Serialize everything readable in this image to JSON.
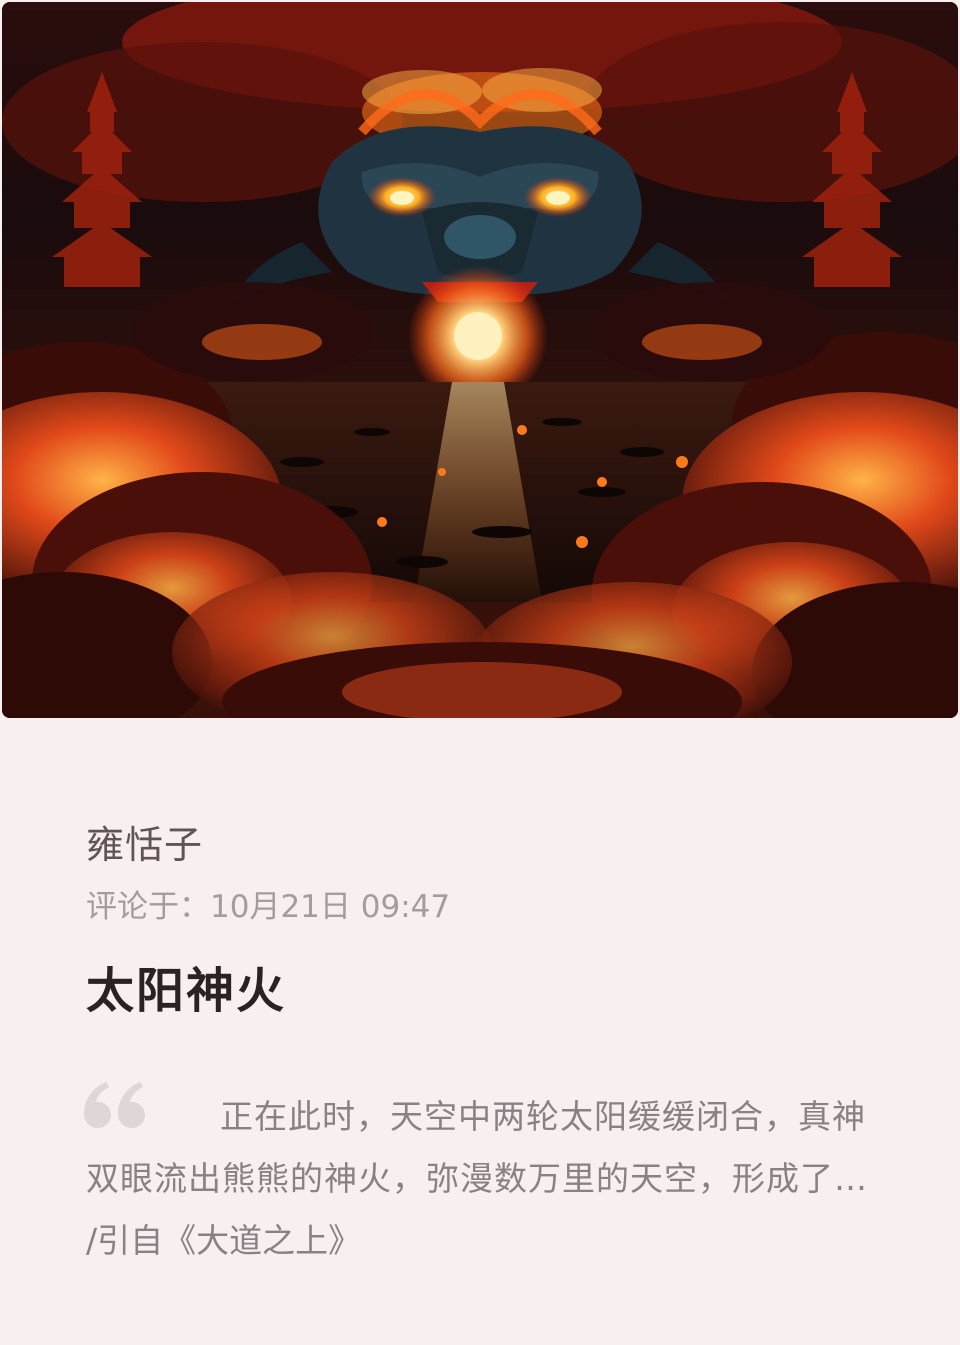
{
  "hero_image": {
    "subject": "dragon-face-over-burning-sea-illustration",
    "colors": {
      "sky_dark": "#1a0b0c",
      "fire_red": "#c21f10",
      "fire_orange": "#ff7a1a",
      "sun_glow": "#ffd27a",
      "dragon_skin": "#1f3440"
    }
  },
  "post": {
    "author": "雍恬子",
    "meta": "评论于：10月21日 09:47",
    "title": "太阳神火",
    "excerpt": "正在此时，天空中两轮太阳缓缓闭合，真神双眼流出熊熊的神火，弥漫数万里的天空，形成了一片火海，无数战船在火中燃烧……",
    "source": "/引自《大道之上》",
    "quote_icon": "quote-icon"
  },
  "theme": {
    "background": "#f7eff0",
    "author_color": "#5f5557",
    "meta_color": "#a59c9e",
    "title_color": "#2b2224",
    "text_color": "#8a8183",
    "quote_color": "#ded6d7"
  }
}
